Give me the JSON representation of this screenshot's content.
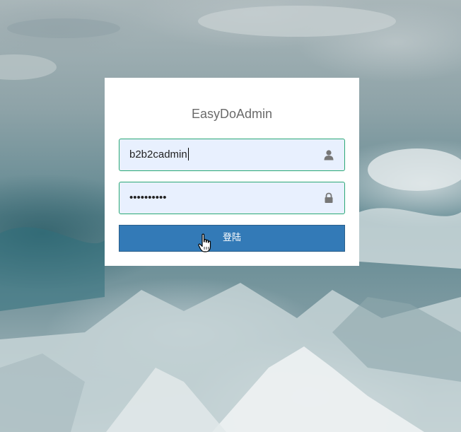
{
  "login": {
    "title": "EasyDoAdmin",
    "username": {
      "value": "b2b2cadmin",
      "icon": "user-icon"
    },
    "password": {
      "value": "••••••••••",
      "icon": "lock-icon"
    },
    "submit_label": "登陆"
  },
  "colors": {
    "button": "#337ab7",
    "field_border": "#2aa876",
    "field_background": "#e8f0fe",
    "title_text": "#6a6a6a"
  }
}
